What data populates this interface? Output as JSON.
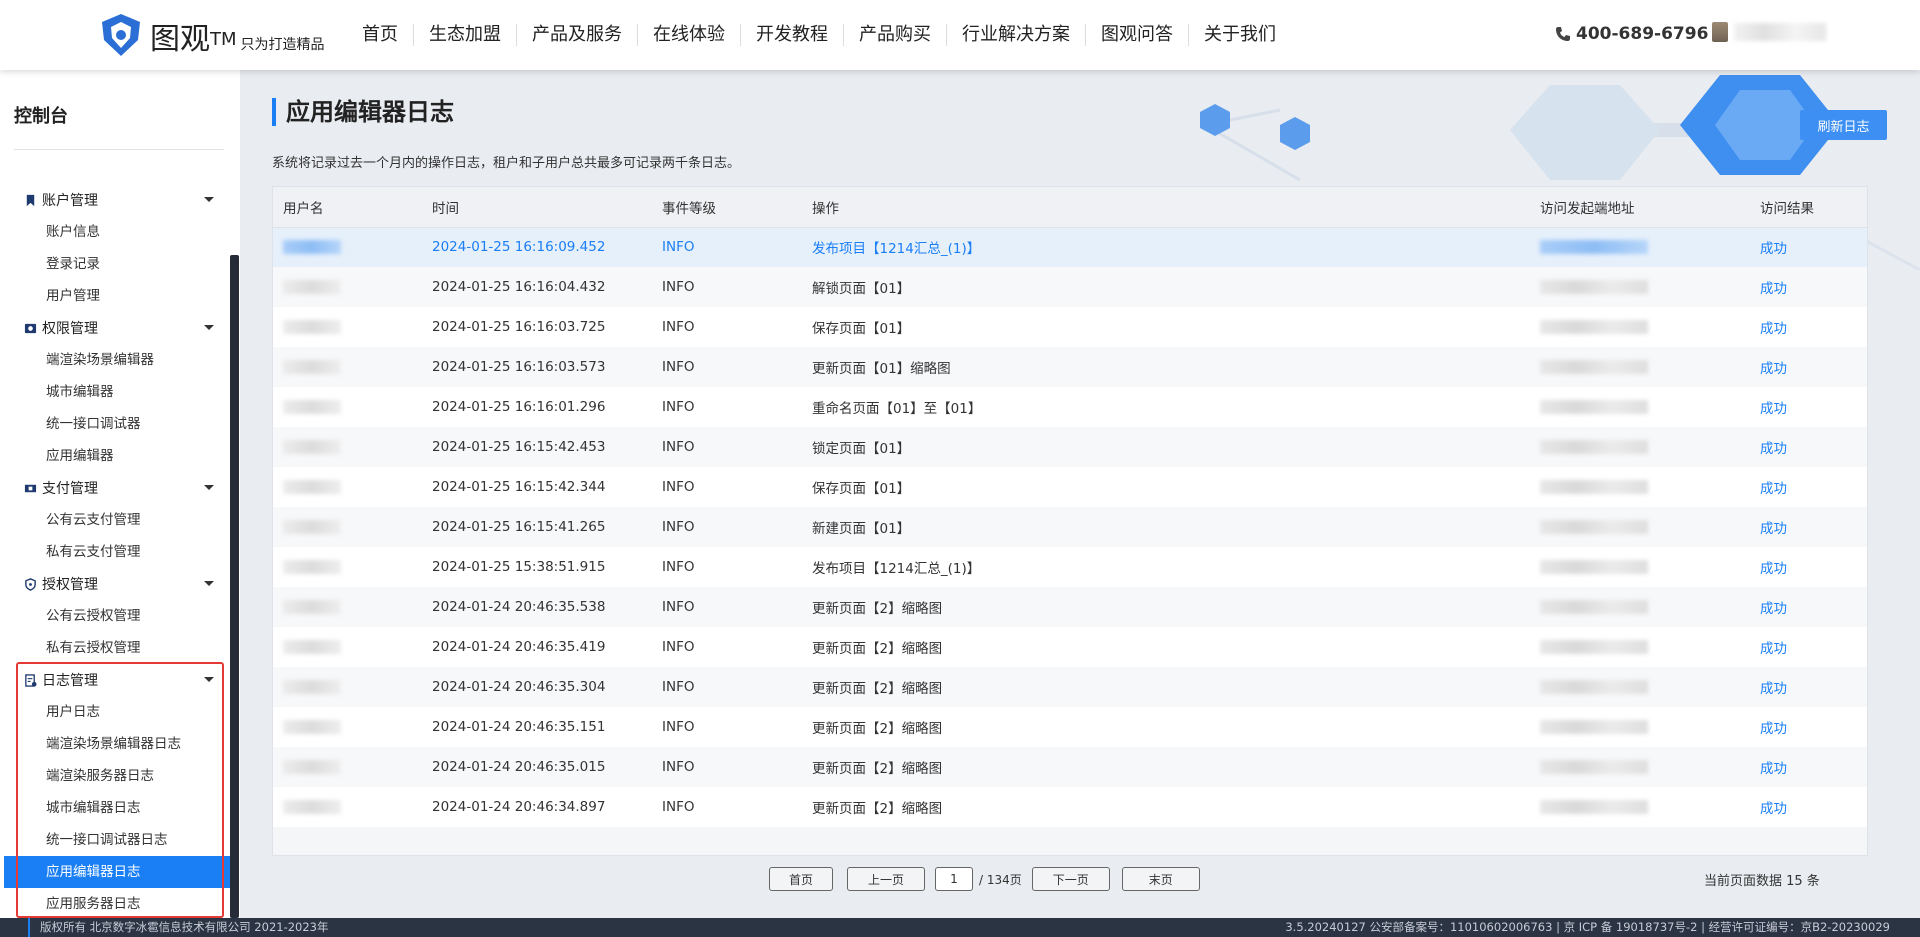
{
  "header": {
    "logo_name": "图观",
    "logo_tm": "TM",
    "logo_slogan": "只为打造精品",
    "nav": [
      "首页",
      "生态加盟",
      "产品及服务",
      "在线体验",
      "开发教程",
      "产品购买",
      "行业解决方案",
      "图观问答",
      "关于我们"
    ],
    "phone": "400-689-6796"
  },
  "sidebar": {
    "title": "控制台",
    "groups": [
      {
        "label": "账户管理",
        "icon": "bookmark-icon",
        "items": [
          "账户信息",
          "登录记录",
          "用户管理"
        ]
      },
      {
        "label": "权限管理",
        "icon": "permission-icon",
        "items": [
          "端渲染场景编辑器",
          "城市编辑器",
          "统一接口调试器",
          "应用编辑器"
        ]
      },
      {
        "label": "支付管理",
        "icon": "ticket-icon",
        "items": [
          "公有云支付管理",
          "私有云支付管理"
        ]
      },
      {
        "label": "授权管理",
        "icon": "shield-icon",
        "items": [
          "公有云授权管理",
          "私有云授权管理"
        ]
      },
      {
        "label": "日志管理",
        "icon": "log-icon",
        "items": [
          "用户日志",
          "端渲染场景编辑器日志",
          "端渲染服务器日志",
          "城市编辑器日志",
          "统一接口调试器日志",
          "应用编辑器日志",
          "应用服务器日志"
        ]
      }
    ],
    "active_item": "应用编辑器日志"
  },
  "main": {
    "title": "应用编辑器日志",
    "description": "系统将记录过去一个月内的操作日志，租户和子用户总共最多可记录两千条日志。",
    "refresh_label": "刷新日志",
    "columns": [
      "用户名",
      "时间",
      "事件等级",
      "操作",
      "访问发起端地址",
      "访问结果"
    ],
    "rows": [
      {
        "time": "2024-01-25 16:16:09.452",
        "level": "INFO",
        "op": "发布项目【1214汇总_(1)】",
        "result": "成功"
      },
      {
        "time": "2024-01-25 16:16:04.432",
        "level": "INFO",
        "op": "解锁页面【01】",
        "result": "成功"
      },
      {
        "time": "2024-01-25 16:16:03.725",
        "level": "INFO",
        "op": "保存页面【01】",
        "result": "成功"
      },
      {
        "time": "2024-01-25 16:16:03.573",
        "level": "INFO",
        "op": "更新页面【01】缩略图",
        "result": "成功"
      },
      {
        "time": "2024-01-25 16:16:01.296",
        "level": "INFO",
        "op": "重命名页面【01】至【01】",
        "result": "成功"
      },
      {
        "time": "2024-01-25 16:15:42.453",
        "level": "INFO",
        "op": "锁定页面【01】",
        "result": "成功"
      },
      {
        "time": "2024-01-25 16:15:42.344",
        "level": "INFO",
        "op": "保存页面【01】",
        "result": "成功"
      },
      {
        "time": "2024-01-25 16:15:41.265",
        "level": "INFO",
        "op": "新建页面【01】",
        "result": "成功"
      },
      {
        "time": "2024-01-25 15:38:51.915",
        "level": "INFO",
        "op": "发布项目【1214汇总_(1)】",
        "result": "成功"
      },
      {
        "time": "2024-01-24 20:46:35.538",
        "level": "INFO",
        "op": "更新页面【2】缩略图",
        "result": "成功"
      },
      {
        "time": "2024-01-24 20:46:35.419",
        "level": "INFO",
        "op": "更新页面【2】缩略图",
        "result": "成功"
      },
      {
        "time": "2024-01-24 20:46:35.304",
        "level": "INFO",
        "op": "更新页面【2】缩略图",
        "result": "成功"
      },
      {
        "time": "2024-01-24 20:46:35.151",
        "level": "INFO",
        "op": "更新页面【2】缩略图",
        "result": "成功"
      },
      {
        "time": "2024-01-24 20:46:35.015",
        "level": "INFO",
        "op": "更新页面【2】缩略图",
        "result": "成功"
      },
      {
        "time": "2024-01-24 20:46:34.897",
        "level": "INFO",
        "op": "更新页面【2】缩略图",
        "result": "成功"
      }
    ]
  },
  "pager": {
    "first": "首页",
    "prev": "上一页",
    "current": "1",
    "total": "/ 134页",
    "next": "下一页",
    "last": "末页",
    "count_text": "当前页面数据 15 条"
  },
  "footer": {
    "left": "版权所有 北京数字冰雹信息技术有限公司 2021-2023年",
    "right": "3.5.20240127 公安部备案号：11010602006763 | 京 ICP 备 19018737号-2 | 经营许可证编号：京B2-20230029"
  },
  "colors": {
    "accent": "#1a7ef5",
    "footer_bg": "#2b3443",
    "highlight": "#e53935"
  }
}
